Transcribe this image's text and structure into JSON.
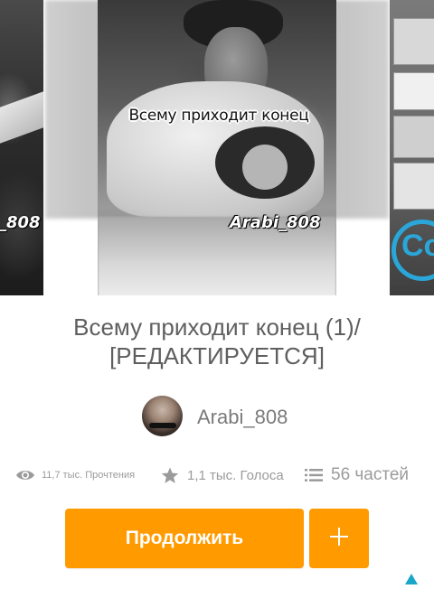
{
  "cover": {
    "caption": "Всему приходит конец",
    "watermark": "Arabi_808",
    "left_watermark": "_808",
    "right_badge": "Co"
  },
  "story": {
    "title": "Всему приходит конец (1)/ [РЕДАКТИРУЕТСЯ]",
    "author": "Arabi_808"
  },
  "stats": {
    "reads": {
      "icon": "eye-icon",
      "label": "11,7 тыс. Прочтения"
    },
    "votes": {
      "icon": "star-icon",
      "label": "1,1 тыс. Голоса"
    },
    "parts": {
      "icon": "list-icon",
      "label": "56 частей"
    }
  },
  "actions": {
    "continue_label": "Продолжить",
    "add_icon": "plus-icon"
  },
  "colors": {
    "accent": "#ff9a00",
    "title_text": "#5f5f5f",
    "stat_text": "#9b9b9b",
    "corner_arrow": "#1aa6c8"
  }
}
